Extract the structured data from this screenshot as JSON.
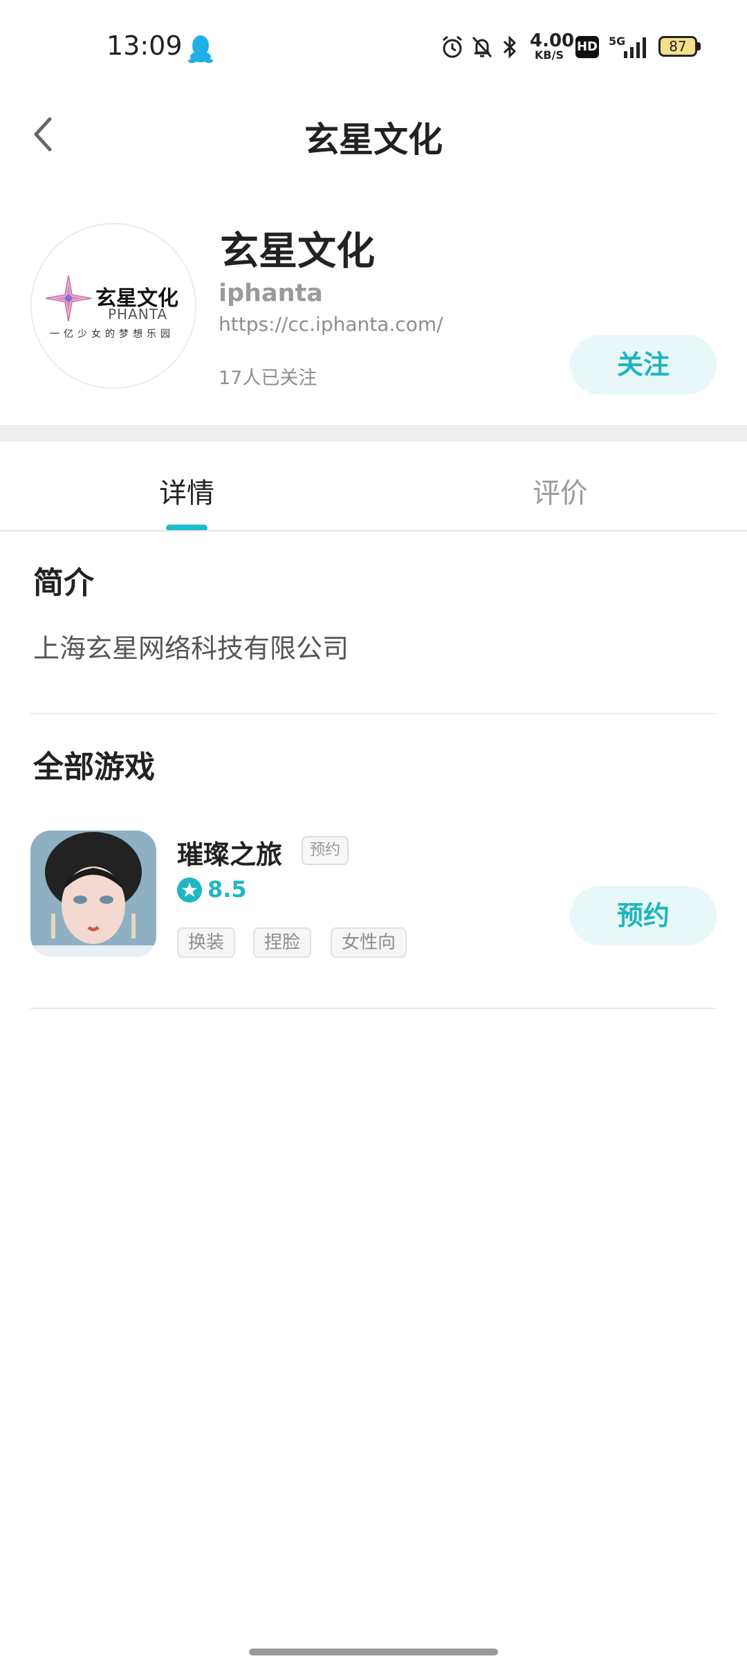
{
  "status_bar": {
    "time": "13:09",
    "net_speed_value": "4.00",
    "net_speed_unit": "KB/S",
    "hd_label": "HD",
    "signal_label": "5G",
    "battery_level": "87",
    "icons": [
      "qq-penguin-icon",
      "alarm-icon",
      "bell-off-icon",
      "bluetooth-icon",
      "signal-icon",
      "battery-icon"
    ]
  },
  "header": {
    "title": "玄星文化"
  },
  "profile": {
    "logo": {
      "name_cn": "玄星文化",
      "name_en": "PHANTA",
      "slogan": "一亿少女的梦想乐园"
    },
    "name": "玄星文化",
    "subtitle": "iphanta",
    "url": "https://cc.iphanta.com/",
    "followers": "17人已关注",
    "follow_label": "关注"
  },
  "tabs": [
    {
      "label": "详情",
      "active": true
    },
    {
      "label": "评价",
      "active": false
    }
  ],
  "intro": {
    "title": "简介",
    "text": "上海玄星网络科技有限公司"
  },
  "games_section": {
    "title": "全部游戏",
    "games": [
      {
        "name": "璀璨之旅",
        "status_badge": "预约",
        "rating": "8.5",
        "tags": [
          "换装",
          "捏脸",
          "女性向"
        ],
        "action_label": "预约"
      }
    ]
  },
  "colors": {
    "accent": "#1fb7c2",
    "button_bg": "#e8f8f9",
    "battery_fill": "#f6e08a"
  }
}
